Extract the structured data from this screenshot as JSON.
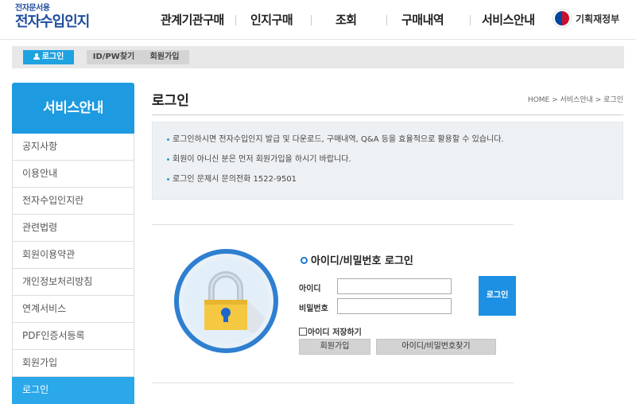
{
  "header": {
    "logo_sub": "전자문서용",
    "logo_main": "전자수입인지",
    "nav": [
      "관계기관구매",
      "인지구매",
      "조회",
      "구매내역",
      "서비스안내"
    ],
    "ministry": "기획재정부"
  },
  "subbar": {
    "login": "로그인",
    "find": "ID/PW찾기",
    "join": "회원가입"
  },
  "sidebar": {
    "title": "서비스안내",
    "items": [
      {
        "label": "공지사항"
      },
      {
        "label": "이용안내"
      },
      {
        "label": "전자수입인지란"
      },
      {
        "label": "관련법령"
      },
      {
        "label": "회원이용약관"
      },
      {
        "label": "개인정보처리방침"
      },
      {
        "label": "연계서비스"
      },
      {
        "label": "PDF인증서등록"
      },
      {
        "label": "회원가입"
      },
      {
        "label": "로그인"
      }
    ],
    "active_index": 9
  },
  "main": {
    "title": "로그인",
    "breadcrumb": "HOME > 서비스안내 > 로그인",
    "notices": [
      "로그인하시면 전자수입인지 발급 및 다운로드, 구매내역, Q&A 등을 효율적으로 활용할 수 있습니다.",
      "회원이 아니신 분은 먼저 회원가입을 하시기 바랍니다.",
      "로그인 문제시 문의전화 1522-9501"
    ]
  },
  "login": {
    "title": "아이디/비밀번호 로그인",
    "id_label": "아이디",
    "pw_label": "비밀번호",
    "id_value": "",
    "pw_value": "",
    "login_button": "로그인",
    "save_id": "아이디 저장하기",
    "join_button": "회원가입",
    "find_button": "아이디/비밀번호찾기"
  },
  "colors": {
    "accent": "#1e9be0",
    "active_item": "#2aa8ea",
    "login_button": "#1e90e4",
    "lock_ring": "#2f7fd1",
    "lock_body": "#f5c842"
  },
  "icons": [
    "person-icon",
    "ministry-logo",
    "ring-icon",
    "lock-illustration"
  ]
}
